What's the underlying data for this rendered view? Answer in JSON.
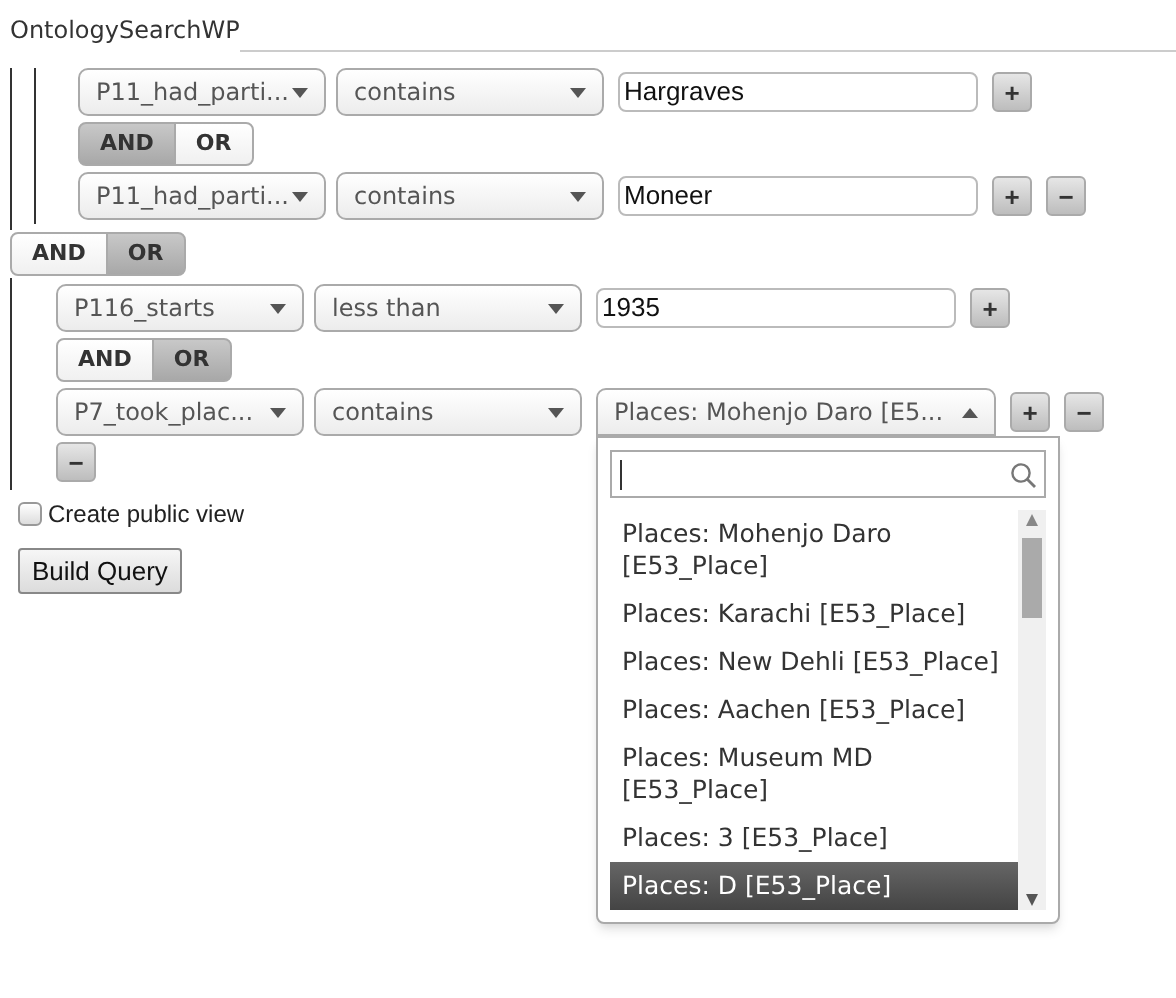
{
  "title": "OntologySearchWP",
  "query": [
    {
      "kind": "group",
      "children": [
        {
          "kind": "condition",
          "property": "P11_had_parti...",
          "operator": "contains",
          "value": {
            "kind": "text",
            "value": "Hargraves"
          },
          "buttons": [
            "+"
          ]
        },
        {
          "kind": "connector",
          "options": [
            {
              "label": "AND",
              "selected": true
            },
            {
              "label": "OR",
              "selected": false
            }
          ]
        },
        {
          "kind": "condition",
          "property": "P11_had_parti...",
          "operator": "contains",
          "value": {
            "kind": "text",
            "value": "Moneer"
          },
          "buttons": [
            "+",
            "−"
          ]
        }
      ]
    },
    {
      "kind": "outer_connector",
      "options": [
        {
          "label": "AND",
          "selected": false
        },
        {
          "label": "OR",
          "selected": true
        }
      ]
    },
    {
      "kind": "condition",
      "property": "P116_starts",
      "operator": "less than",
      "value": {
        "kind": "text",
        "value": "1935"
      },
      "buttons": [
        "+"
      ]
    },
    {
      "kind": "connector",
      "options": [
        {
          "label": "AND",
          "selected": false
        },
        {
          "label": "OR",
          "selected": true
        }
      ]
    },
    {
      "kind": "condition",
      "property": "P7_took_plac...",
      "operator": "contains",
      "value": {
        "kind": "combo",
        "value": "Places: Mohenjo Daro [E5...",
        "open": true,
        "options": [
          {
            "label": "Places: Mohenjo Daro [E53_Place]",
            "selected": false
          },
          {
            "label": "Places: Karachi [E53_Place]",
            "selected": false
          },
          {
            "label": "Places: New Dehli [E53_Place]",
            "selected": false
          },
          {
            "label": "Places: Aachen [E53_Place]",
            "selected": false
          },
          {
            "label": "Places: Museum MD [E53_Place]",
            "selected": false
          },
          {
            "label": "Places: 3 [E53_Place]",
            "selected": false
          },
          {
            "label": "Places: D [E53_Place]",
            "selected": true
          }
        ]
      },
      "buttons": [
        "+",
        "−"
      ]
    },
    {
      "kind": "remove",
      "label": "−"
    }
  ],
  "public_view": {
    "label": "Create public view",
    "checked": false
  },
  "build_button": "Build Query"
}
